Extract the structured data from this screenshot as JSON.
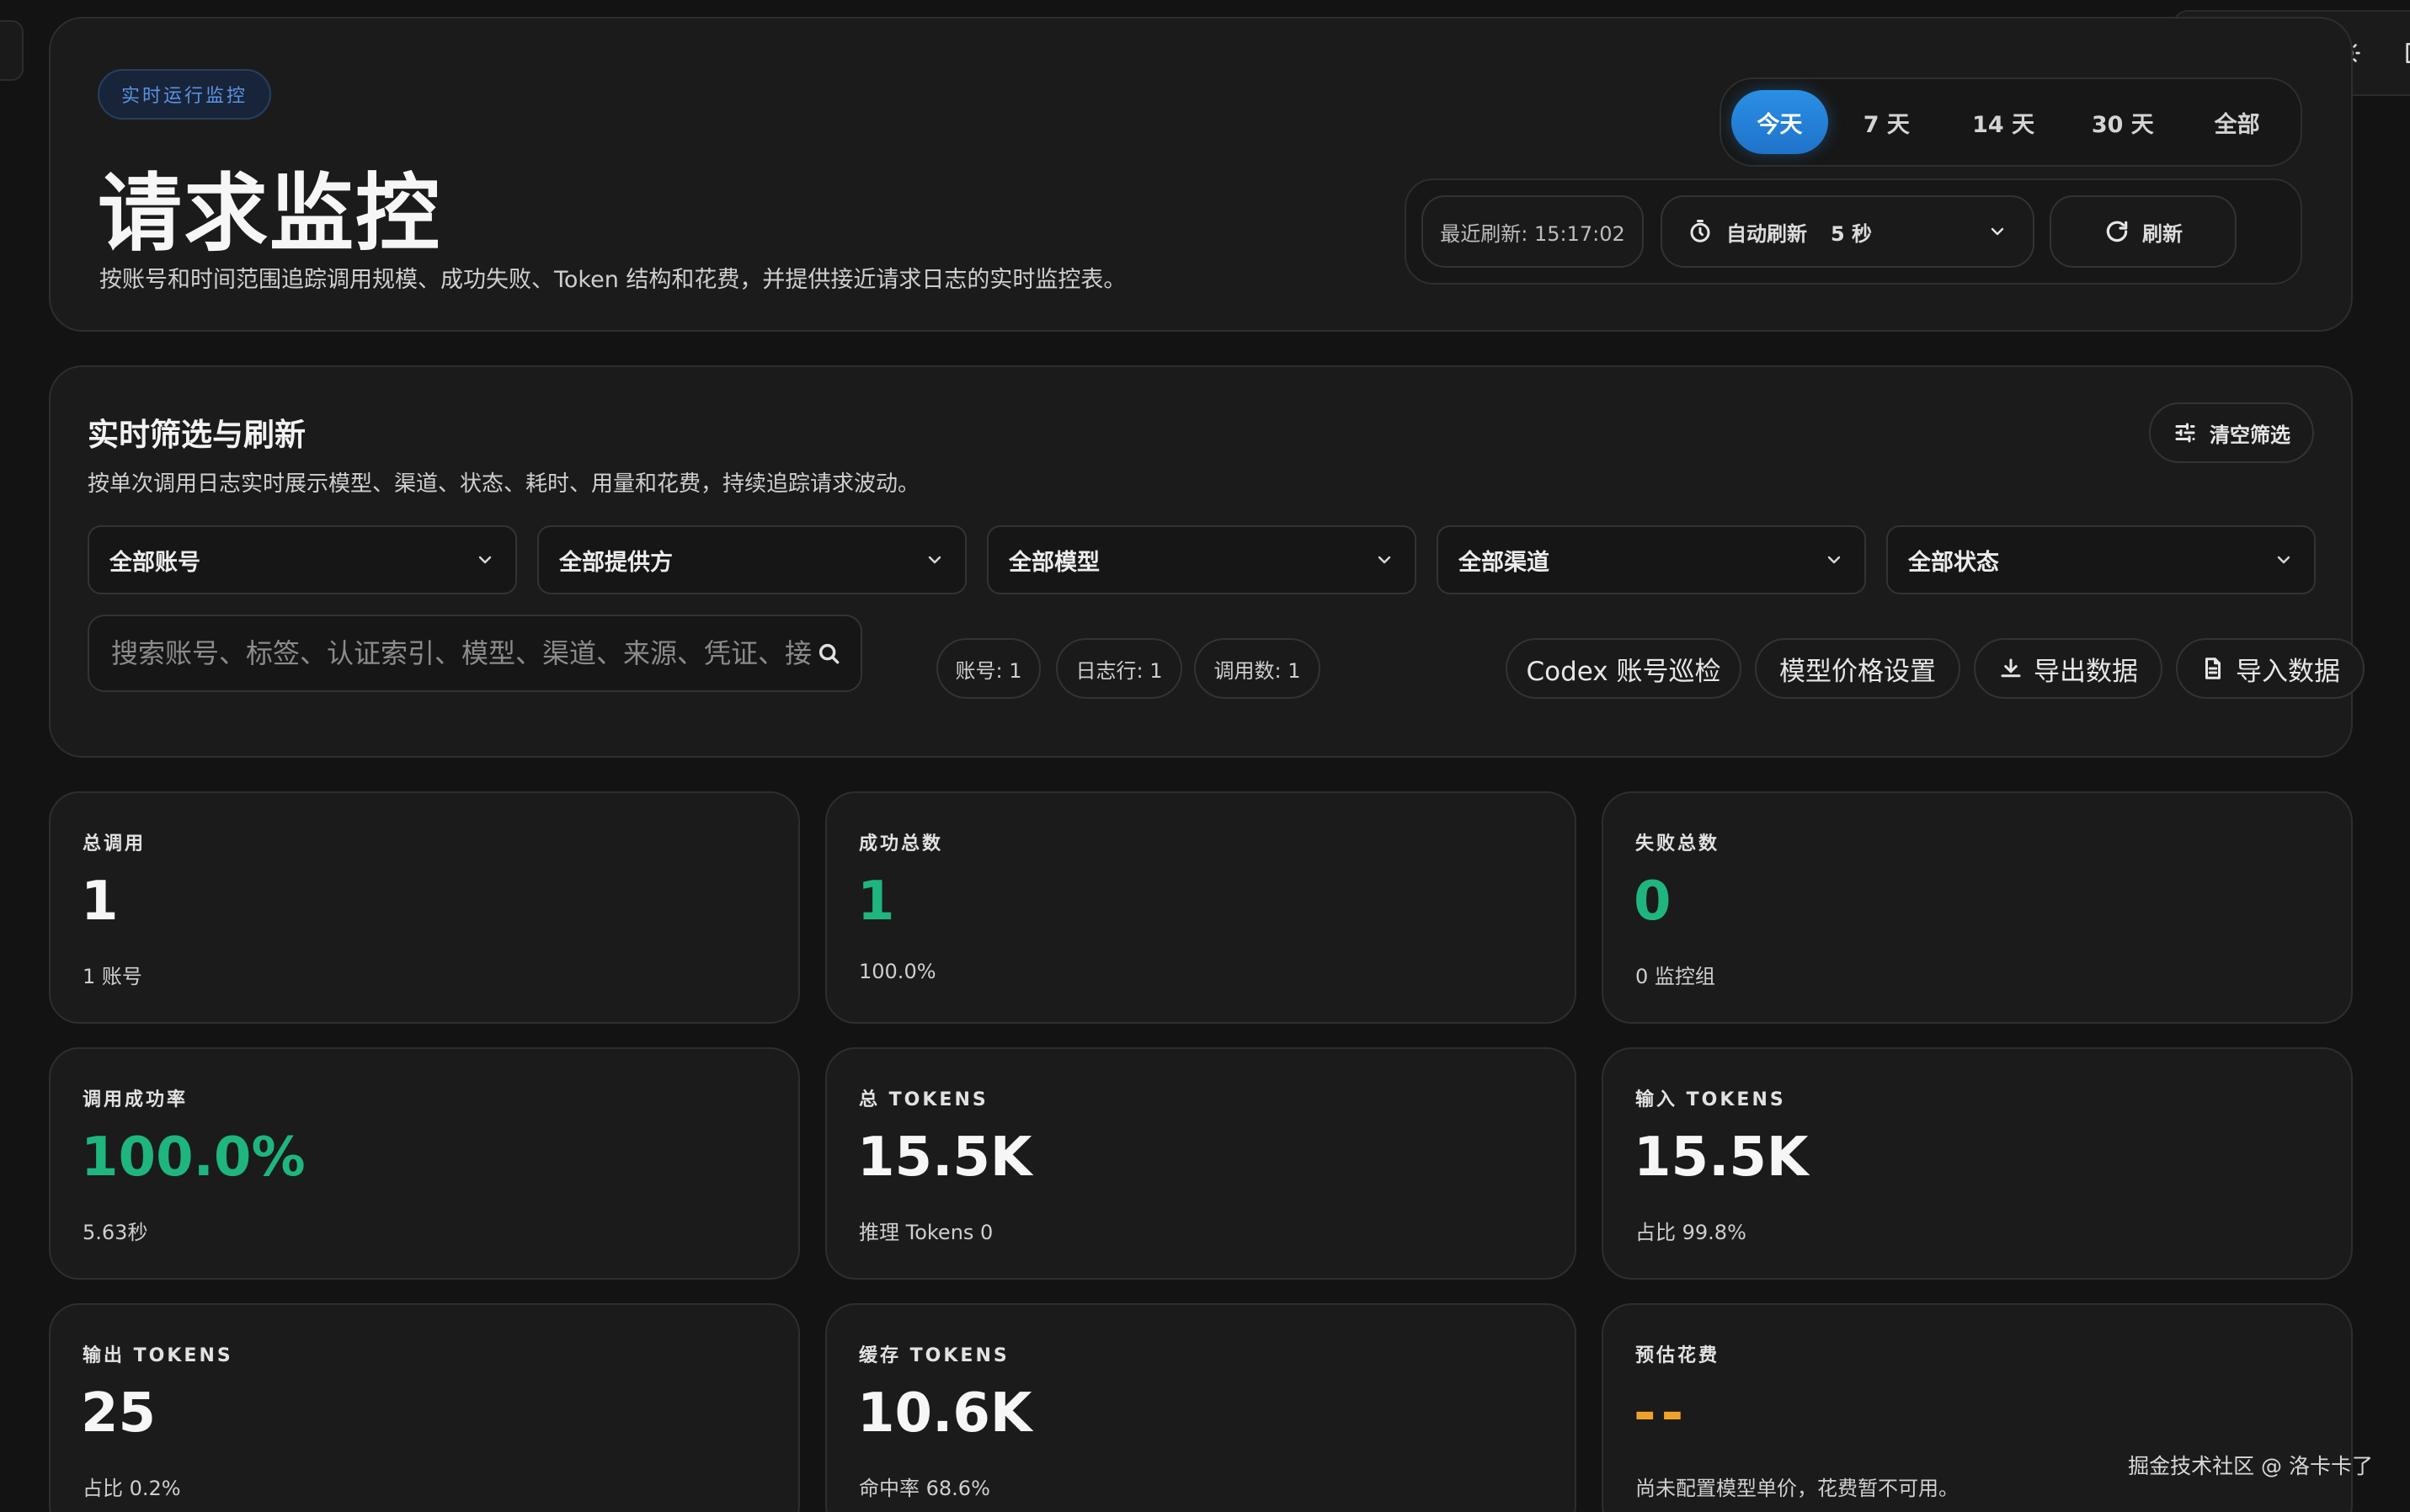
{
  "toolbar": {
    "icons": [
      "refresh-icon",
      "globe-icon",
      "sun-icon",
      "logout-icon"
    ]
  },
  "hero": {
    "eyebrow": "实时运行监控",
    "title": "请求监控",
    "description": "按账号和时间范围追踪调用规模、成功失败、Token 结构和花费，并提供接近请求日志的实时监控表。"
  },
  "range_tabs": [
    {
      "label": "今天",
      "active": true
    },
    {
      "label": "7 天",
      "active": false
    },
    {
      "label": "14 天",
      "active": false
    },
    {
      "label": "30 天",
      "active": false
    },
    {
      "label": "全部",
      "active": false
    }
  ],
  "refresh": {
    "last_refresh": "最近刷新: 15:17:02",
    "auto_refresh_label": "自动刷新",
    "auto_refresh_value": "5 秒",
    "refresh_button": "刷新"
  },
  "filters": {
    "title": "实时筛选与刷新",
    "description": "按单次调用日志实时展示模型、渠道、状态、耗时、用量和花费，持续追踪请求波动。",
    "clear_button": "清空筛选",
    "selects": [
      {
        "value": "全部账号"
      },
      {
        "value": "全部提供方"
      },
      {
        "value": "全部模型"
      },
      {
        "value": "全部渠道"
      },
      {
        "value": "全部状态"
      }
    ],
    "search_placeholder": "搜索账号、标签、认证索引、模型、渠道、来源、凭证、接",
    "stats": [
      "账号: 1",
      "日志行: 1",
      "调用数: 1"
    ],
    "actions": {
      "inspect": "Codex 账号巡检",
      "pricing": "模型价格设置",
      "export": "导出数据",
      "import": "导入数据"
    }
  },
  "cards": [
    {
      "label": "总调用",
      "value": "1",
      "sub": "1 账号",
      "color": "#f6f6f6"
    },
    {
      "label": "成功总数",
      "value": "1",
      "sub": "100.0%",
      "color": "#1fb57e"
    },
    {
      "label": "失败总数",
      "value": "0",
      "sub": "0 监控组",
      "color": "#1fb57e"
    },
    {
      "label": "调用成功率",
      "value": "100.0%",
      "sub": "5.63秒",
      "color": "#1fb57e"
    },
    {
      "label": "总 TOKENS",
      "value": "15.5K",
      "sub": "推理 Tokens 0",
      "color": "#f6f6f6"
    },
    {
      "label": "输入 TOKENS",
      "value": "15.5K",
      "sub": "占比 99.8%",
      "color": "#f6f6f6"
    },
    {
      "label": "输出 TOKENS",
      "value": "25",
      "sub": "占比 0.2%",
      "color": "#f6f6f6"
    },
    {
      "label": "缓存 TOKENS",
      "value": "10.6K",
      "sub": "命中率 68.6%",
      "color": "#f6f6f6"
    },
    {
      "label": "预估花费",
      "value": "--",
      "sub": "尚未配置模型单价，花费暂不可用。",
      "color": "#f0a12a"
    }
  ],
  "watermark": "掘金技术社区 @ 洛卡卡了"
}
